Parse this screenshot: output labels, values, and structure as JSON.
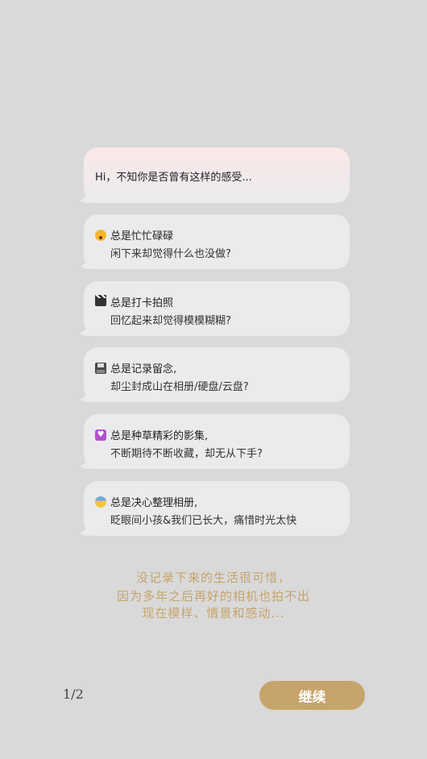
{
  "intro": {
    "greeting": "Hi，不知你是否曾有这样的感受..."
  },
  "bubbles": [
    {
      "icon": "dizzy-face-icon",
      "line1": "总是忙忙碌碌",
      "line2": "闲下来却觉得什么也没做?"
    },
    {
      "icon": "clapperboard-icon",
      "line1": "总是打卡拍照",
      "line2": "回忆起来却觉得模模糊糊?"
    },
    {
      "icon": "floppy-disk-icon",
      "line1": "总是记录留念,",
      "line2": "却尘封成山在相册/硬盘/云盘?"
    },
    {
      "icon": "heart-icon",
      "line1": "总是种草精彩的影集,",
      "line2": "不断期待不断收藏，却无从下手?"
    },
    {
      "icon": "fearful-face-icon",
      "line1": "总是决心整理相册,",
      "line2": "眨眼间小孩&我们已长大，痛惜时光太快"
    }
  ],
  "closing": {
    "line1": "没记录下来的生活很可惜，",
    "line2": "因为多年之后再好的相机也拍不出",
    "line3": "现在模样、情景和感动..."
  },
  "footer": {
    "page_indicator": "1/2",
    "continue_label": "继续"
  },
  "colors": {
    "background": "#d9d9d9",
    "bubble": "#ebebed",
    "accent_gold": "#c6a46c",
    "closing_text": "#c5a46b"
  }
}
